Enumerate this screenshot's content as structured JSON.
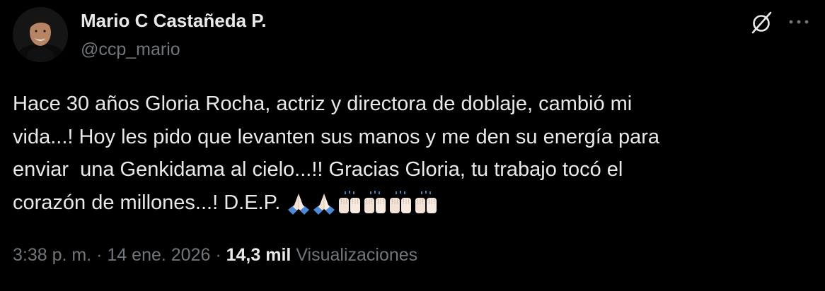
{
  "author": {
    "display_name": "Mario C Castañeda P.",
    "handle": "@ccp_mario",
    "avatar_icon": "profile-photo"
  },
  "header_actions": {
    "grok_icon": "grok-icon",
    "more_icon": "more-horizontal-icon"
  },
  "tweet": {
    "lines": [
      "Hace 30 años Gloria Rocha, actriz y directora de doblaje, cambió mi",
      "vida...! Hoy les pido que levanten sus manos y me den su energía para",
      "enviar  una Genkidama al cielo...!! Gracias Gloria, tu trabajo tocó el",
      "corazón de millones...! D.E.P."
    ],
    "emojis": [
      "folded-hands",
      "folded-hands",
      "raising-hands",
      "raising-hands",
      "raising-hands",
      "raising-hands"
    ]
  },
  "meta": {
    "time": "3:38 p. m.",
    "separator": "·",
    "date": "14 ene. 2026",
    "views_count": "14,3 mil",
    "views_label": "Visualizaciones"
  },
  "colors": {
    "background": "#000000",
    "primary_text": "#e7e9ea",
    "secondary_text": "#71767b"
  }
}
